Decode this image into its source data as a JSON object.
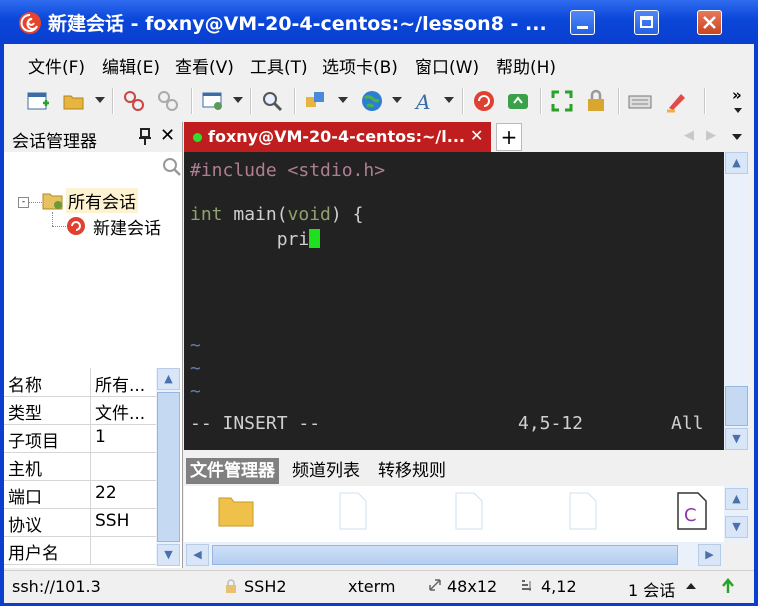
{
  "window": {
    "title": "新建会话 - foxny@VM-20-4-centos:~/lesson8 - ..."
  },
  "menubar": [
    "文件(F)",
    "编辑(E)",
    "查看(V)",
    "工具(T)",
    "选项卡(B)",
    "窗口(W)",
    "帮助(H)"
  ],
  "session_manager": {
    "title": "会话管理器",
    "close": "✕",
    "tree": {
      "root": "所有会话",
      "child": "新建会话"
    },
    "properties": [
      {
        "key": "名称",
        "value": "所有..."
      },
      {
        "key": "类型",
        "value": "文件..."
      },
      {
        "key": "子项目",
        "value": "1"
      },
      {
        "key": "主机",
        "value": ""
      },
      {
        "key": "端口",
        "value": "22"
      },
      {
        "key": "协议",
        "value": "SSH"
      },
      {
        "key": "用户名",
        "value": ""
      }
    ]
  },
  "tab": {
    "label": "foxny@VM-20-4-centos:~/l...",
    "close": "✕",
    "add": "+"
  },
  "terminal": {
    "line1": "#include <stdio.h>",
    "line2_kw": "int",
    "line2_fn": " main(",
    "line2_arg": "void",
    "line2_rest": ") {",
    "line3": "        pri",
    "tilde": "~",
    "mode": "-- INSERT --",
    "position": "4,5-12",
    "scope": "All"
  },
  "file_panel": {
    "tabs": [
      "文件管理器",
      "频道列表",
      "转移规则"
    ]
  },
  "statusbar": {
    "connection": "ssh://101.3",
    "protocol": "SSH2",
    "term": "xterm",
    "size": "48x12",
    "cursor": "4,12",
    "sessions": "1 会话"
  },
  "colors": {
    "titlebar": "#0a46d8",
    "tab_active": "#c01e1e",
    "terminal_bg": "#222222",
    "cursor": "#1ee01e",
    "comment": "#b07e92",
    "keyword": "#8fa26b"
  }
}
